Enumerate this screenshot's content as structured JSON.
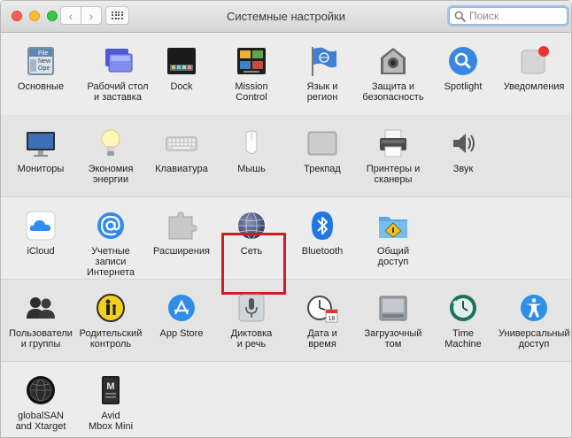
{
  "window": {
    "title": "Системные настройки",
    "search_placeholder": "Поиск",
    "nav": {
      "back_glyph": "‹",
      "forward_glyph": "›"
    }
  },
  "rows": [
    [
      {
        "id": "general",
        "label": "Основные",
        "icon": "general-icon"
      },
      {
        "id": "desktop",
        "label": "Рабочий стол\nи заставка",
        "icon": "desktop-screensaver-icon"
      },
      {
        "id": "dock",
        "label": "Dock",
        "icon": "dock-icon"
      },
      {
        "id": "mission",
        "label": "Mission\nControl",
        "icon": "mission-control-icon"
      },
      {
        "id": "language",
        "label": "Язык и\nрегион",
        "icon": "language-region-icon"
      },
      {
        "id": "security",
        "label": "Защита и\nбезопасность",
        "icon": "security-icon"
      },
      {
        "id": "spotlight",
        "label": "Spotlight",
        "icon": "spotlight-icon"
      },
      {
        "id": "notifications",
        "label": "Уведомления",
        "icon": "notifications-icon"
      }
    ],
    [
      {
        "id": "displays",
        "label": "Мониторы",
        "icon": "displays-icon"
      },
      {
        "id": "energy",
        "label": "Экономия\nэнергии",
        "icon": "energy-saver-icon"
      },
      {
        "id": "keyboard",
        "label": "Клавиатура",
        "icon": "keyboard-icon"
      },
      {
        "id": "mouse",
        "label": "Мышь",
        "icon": "mouse-icon"
      },
      {
        "id": "trackpad",
        "label": "Трекпад",
        "icon": "trackpad-icon"
      },
      {
        "id": "printers",
        "label": "Принтеры и\nсканеры",
        "icon": "printer-icon"
      },
      {
        "id": "sound",
        "label": "Звук",
        "icon": "sound-icon"
      }
    ],
    [
      {
        "id": "icloud",
        "label": "iCloud",
        "icon": "icloud-icon"
      },
      {
        "id": "internet-accounts",
        "label": "Учетные записи\nИнтернета",
        "icon": "internet-accounts-icon"
      },
      {
        "id": "extensions",
        "label": "Расширения",
        "icon": "extensions-icon"
      },
      {
        "id": "network",
        "label": "Сеть",
        "icon": "network-icon"
      },
      {
        "id": "bluetooth",
        "label": "Bluetooth",
        "icon": "bluetooth-icon"
      },
      {
        "id": "sharing",
        "label": "Общий\nдоступ",
        "icon": "sharing-icon"
      }
    ],
    [
      {
        "id": "users",
        "label": "Пользователи\nи группы",
        "icon": "users-groups-icon"
      },
      {
        "id": "parental",
        "label": "Родительский\nконтроль",
        "icon": "parental-controls-icon"
      },
      {
        "id": "appstore",
        "label": "App Store",
        "icon": "app-store-icon"
      },
      {
        "id": "dictation",
        "label": "Диктовка\nи речь",
        "icon": "dictation-microphone-icon"
      },
      {
        "id": "datetime",
        "label": "Дата и\nвремя",
        "icon": "date-time-icon"
      },
      {
        "id": "startup",
        "label": "Загрузочный\nтом",
        "icon": "startup-disk-icon"
      },
      {
        "id": "timemachine",
        "label": "Time\nMachine",
        "icon": "time-machine-icon"
      },
      {
        "id": "accessibility",
        "label": "Универсальный\nдоступ",
        "icon": "accessibility-icon"
      }
    ],
    [
      {
        "id": "globalsan",
        "label": "globalSAN\nand Xtarget",
        "icon": "globalsan-icon"
      },
      {
        "id": "avid",
        "label": "Avid\nMbox Mini",
        "icon": "avid-mbox-icon"
      }
    ]
  ],
  "icon_texts": {
    "general_file": "File",
    "general_new": "New",
    "general_ope": "Ope",
    "calendar_day": "18",
    "avid_letter": "M"
  },
  "colors": {
    "highlight_border": "#cc1f24",
    "alt_row": "#e4e4e4",
    "row": "#ececec"
  }
}
